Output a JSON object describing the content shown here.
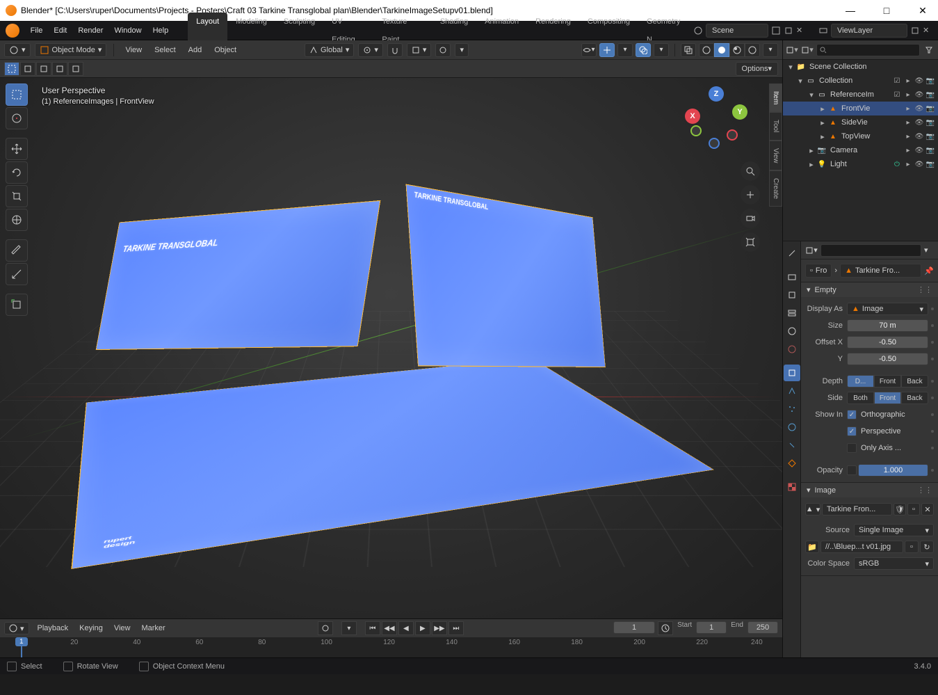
{
  "window": {
    "title": "Blender* [C:\\Users\\ruper\\Documents\\Projects - Posters\\Craft 03 Tarkine Transglobal plan\\Blender\\TarkineImageSetupv01.blend]"
  },
  "menu": {
    "file": "File",
    "edit": "Edit",
    "render": "Render",
    "window": "Window",
    "help": "Help"
  },
  "workspaces": [
    "Layout",
    "Modeling",
    "Sculpting",
    "UV Editing",
    "Texture Paint",
    "Shading",
    "Animation",
    "Rendering",
    "Compositing",
    "Geometry N"
  ],
  "workspace_active": "Layout",
  "scene": {
    "label": "Scene",
    "viewlayer": "ViewLayer"
  },
  "viewheader": {
    "mode": "Object Mode",
    "view": "View",
    "select": "Select",
    "add": "Add",
    "object": "Object",
    "orient": "Global",
    "options": "Options"
  },
  "overlay": {
    "line1": "User Perspective",
    "line2": "(1) ReferenceImages | FrontView"
  },
  "ntabs": [
    "Item",
    "Tool",
    "View",
    "Create"
  ],
  "outliner": {
    "root": "Scene Collection",
    "items": [
      {
        "name": "Collection",
        "type": "collection",
        "depth": 1,
        "exp": true
      },
      {
        "name": "ReferenceIm",
        "type": "collection",
        "depth": 2,
        "exp": true
      },
      {
        "name": "FrontVie",
        "type": "image",
        "depth": 3,
        "sel": true
      },
      {
        "name": "SideVie",
        "type": "image",
        "depth": 3
      },
      {
        "name": "TopView",
        "type": "image",
        "depth": 3
      },
      {
        "name": "Camera",
        "type": "camera",
        "depth": 2
      },
      {
        "name": "Light",
        "type": "light",
        "depth": 2
      }
    ]
  },
  "breadcrumb": {
    "a": "Fro",
    "b": "Tarkine Fro..."
  },
  "empty_panel": {
    "title": "Empty",
    "display_as": "Image",
    "size": "70 m",
    "offx": "-0.50",
    "offy": "-0.50",
    "depth": [
      "D...",
      "Front",
      "Back"
    ],
    "depth_active": 0,
    "side": [
      "Both",
      "Front",
      "Back"
    ],
    "side_active": 1,
    "orthographic": true,
    "perspective": true,
    "only_axis": false,
    "opacity": "1.000",
    "labels": {
      "display_as": "Display As",
      "size": "Size",
      "offx": "Offset X",
      "offy": "Y",
      "depth": "Depth",
      "side": "Side",
      "showin": "Show In",
      "ortho": "Orthographic",
      "persp": "Perspective",
      "onlyaxis": "Only Axis ...",
      "opacity": "Opacity"
    }
  },
  "image_panel": {
    "title": "Image",
    "name": "Tarkine Fron...",
    "source": "Single Image",
    "path": "//..\\Bluep...t v01.jpg",
    "colorspace": "sRGB",
    "labels": {
      "source": "Source",
      "colorspace": "Color Space"
    }
  },
  "timeline": {
    "playback": "Playback",
    "keying": "Keying",
    "view": "View",
    "marker": "Marker",
    "current": "1",
    "start_l": "Start",
    "start": "1",
    "end_l": "End",
    "end": "250",
    "ticks": [
      20,
      40,
      60,
      80,
      100,
      120,
      140,
      160,
      180,
      200,
      220,
      240
    ]
  },
  "status": {
    "select": "Select",
    "rotate": "Rotate View",
    "ctx": "Object Context Menu",
    "version": "3.4.0"
  },
  "blueprint": {
    "title": "TARKINE TRANSGLOBAL"
  }
}
